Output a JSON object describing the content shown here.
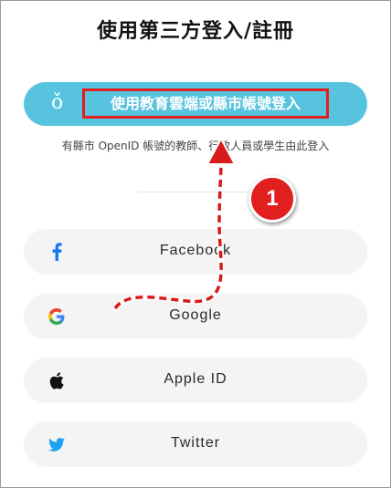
{
  "title": "使用第三方登入/註冊",
  "openid": {
    "icon": "openid-icon",
    "icon_glyph": "ǒ",
    "label": "使用教育雲端或縣市帳號登入",
    "hint": "有縣市 OpenID 帳號的教師、行政人員或學生由此登入"
  },
  "social": [
    {
      "label": "Facebook",
      "icon": "facebook-icon",
      "color": "#1877f2"
    },
    {
      "label": "Google",
      "icon": "google-icon",
      "color": "#4285f4"
    },
    {
      "label": "Apple ID",
      "icon": "apple-icon",
      "color": "#000000"
    },
    {
      "label": "Twitter",
      "icon": "twitter-icon",
      "color": "#1da1f2"
    }
  ],
  "annotation": {
    "step": "1",
    "color": "#e21f1f"
  }
}
